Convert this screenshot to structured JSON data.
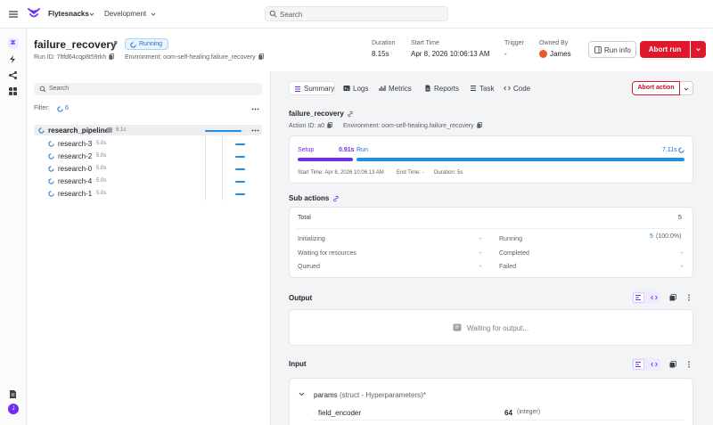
{
  "topbar": {
    "project": "Flytesnacks",
    "domain": "Development",
    "search_placeholder": "Search"
  },
  "rail": {
    "icons": [
      "menu-icon",
      "runs-icon",
      "bolt-icon",
      "share-icon",
      "apps-icon",
      "docs-icon"
    ],
    "avatar_initial": "J"
  },
  "run": {
    "name": "failure_recovery",
    "status": "Running",
    "id_label": "Run ID: 7ltfd64cqp8t59rkh",
    "env_label": "Environment: oom-self-healing.failure_recovery",
    "meta": {
      "duration_label": "Duration",
      "duration": "8.15s",
      "start_label": "Start Time",
      "start": "Apr 8, 2026 10:06:13 AM",
      "trigger_label": "Trigger",
      "trigger": "-",
      "owner_label": "Owned By",
      "owner": "James"
    },
    "run_info_label": "Run info",
    "abort_label": "Abort run"
  },
  "tree": {
    "search_placeholder": "Search",
    "filter_label": "Filter:",
    "filter_count": "6",
    "root": {
      "name": "research_pipeline",
      "duration": "8.1s",
      "progress": 0.9
    },
    "children": [
      {
        "name": "research-3",
        "duration": "5.0s"
      },
      {
        "name": "research-2",
        "duration": "5.0s"
      },
      {
        "name": "research-0",
        "duration": "5.0s"
      },
      {
        "name": "research-4",
        "duration": "5.0s"
      },
      {
        "name": "research-1",
        "duration": "5.0s"
      }
    ]
  },
  "tabs": [
    {
      "label": "Summary",
      "icon": "list-icon",
      "active": true
    },
    {
      "label": "Logs",
      "icon": "terminal-icon"
    },
    {
      "label": "Metrics",
      "icon": "metrics-icon"
    },
    {
      "label": "Reports",
      "icon": "report-icon"
    },
    {
      "label": "Task",
      "icon": "task-icon"
    },
    {
      "label": "Code",
      "icon": "code-icon"
    }
  ],
  "abort_action_label": "Abort action",
  "action": {
    "name": "failure_recovery",
    "id_label": "Action ID: a0",
    "env_label": "Environment: oom-self-healing.failure_recovery"
  },
  "timeline": {
    "setup_label": "Setup",
    "setup_value": "0.91s",
    "run_label": "Run",
    "run_value": "7.11s",
    "start_time": "Start Time: Apr 8, 2026 10:06:13 AM",
    "end_time": "End Time: -",
    "duration": "Duration: 5s"
  },
  "sub_actions": {
    "title": "Sub actions",
    "total_label": "Total",
    "total": "5",
    "rows": [
      {
        "label": "Initializing",
        "value": "-"
      },
      {
        "label": "Waiting for resources",
        "value": "-"
      },
      {
        "label": "Queued",
        "value": "-"
      },
      {
        "label": "Running",
        "value_count": "5",
        "value_pct": "(100.0%)"
      },
      {
        "label": "Completed",
        "value": "-"
      },
      {
        "label": "Failed",
        "value": "-"
      }
    ]
  },
  "output": {
    "title": "Output",
    "waiting_text": "Waiting for output..."
  },
  "input": {
    "title": "Input",
    "param_name": "params",
    "param_type": "(struct - Hyperparameters)*",
    "field_name": "field_encoder",
    "field_value": "64",
    "field_type": "(integer)"
  },
  "colors": {
    "accent": "#6f2cf5",
    "running": "#1e8fe6",
    "danger": "#e0182d"
  }
}
